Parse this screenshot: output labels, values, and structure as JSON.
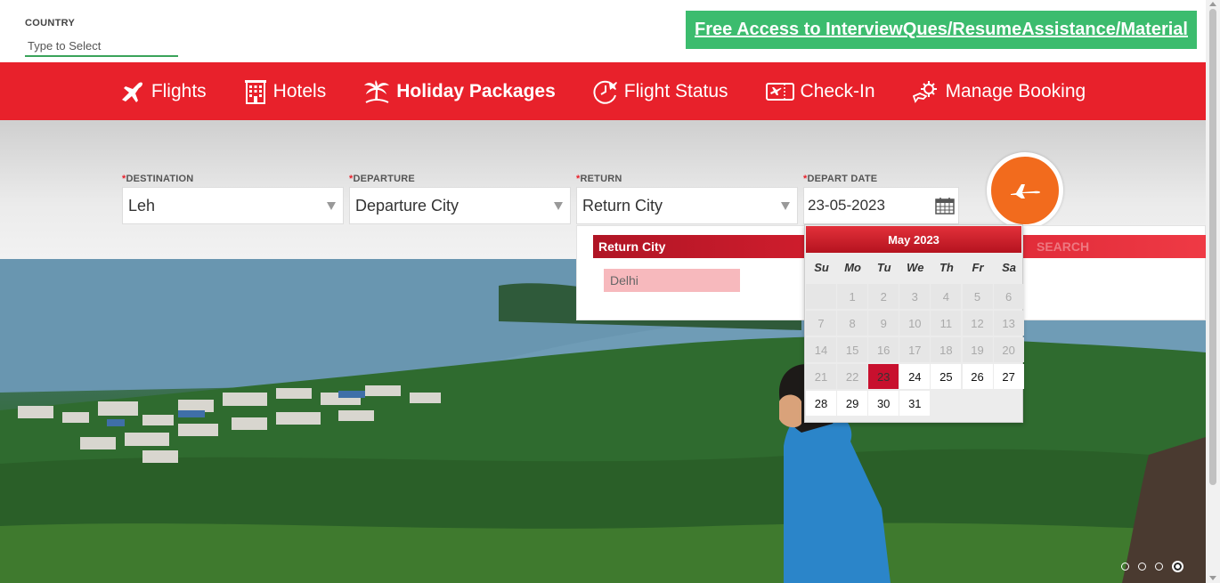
{
  "country": {
    "label": "COUNTRY",
    "placeholder": "Type to Select"
  },
  "promo": {
    "label": "Free Access to InterviewQues/ResumeAssistance/Material"
  },
  "nav": {
    "items": [
      {
        "label": "Flights",
        "icon": "airplane-icon"
      },
      {
        "label": "Hotels",
        "icon": "hotel-building-icon"
      },
      {
        "label": "Holiday Packages",
        "icon": "palm-tree-icon"
      },
      {
        "label": "Flight Status",
        "icon": "flight-clock-icon"
      },
      {
        "label": "Check-In",
        "icon": "boarding-pass-icon"
      },
      {
        "label": "Manage Booking",
        "icon": "gear-hand-icon"
      }
    ],
    "active": "Holiday Packages"
  },
  "form": {
    "destination": {
      "label": "DESTINATION",
      "required": "*",
      "value": "Leh"
    },
    "departure": {
      "label": "DEPARTURE",
      "required": "*",
      "value": "Departure City"
    },
    "return": {
      "label": "RETURN",
      "required": "*",
      "value": "Return City"
    },
    "depart_date": {
      "label": "DEPART DATE",
      "required": "*",
      "value": "23-05-2023"
    }
  },
  "return_dropdown": {
    "header": "Return City",
    "ghost_text": "SEARCH",
    "options": [
      "Delhi"
    ]
  },
  "calendar": {
    "month_label": "May 2023",
    "weekdays": [
      "Su",
      "Mo",
      "Tu",
      "We",
      "Th",
      "Fr",
      "Sa"
    ],
    "days": [
      {
        "d": "1",
        "state": "disabled"
      },
      {
        "d": "2",
        "state": "disabled"
      },
      {
        "d": "3",
        "state": "disabled"
      },
      {
        "d": "4",
        "state": "disabled"
      },
      {
        "d": "5",
        "state": "disabled"
      },
      {
        "d": "6",
        "state": "disabled"
      },
      {
        "d": "7",
        "state": "disabled"
      },
      {
        "d": "8",
        "state": "disabled"
      },
      {
        "d": "9",
        "state": "disabled"
      },
      {
        "d": "10",
        "state": "disabled"
      },
      {
        "d": "11",
        "state": "disabled"
      },
      {
        "d": "12",
        "state": "disabled"
      },
      {
        "d": "13",
        "state": "disabled"
      },
      {
        "d": "14",
        "state": "disabled"
      },
      {
        "d": "15",
        "state": "disabled"
      },
      {
        "d": "16",
        "state": "disabled"
      },
      {
        "d": "17",
        "state": "disabled"
      },
      {
        "d": "18",
        "state": "disabled"
      },
      {
        "d": "19",
        "state": "disabled"
      },
      {
        "d": "20",
        "state": "disabled"
      },
      {
        "d": "21",
        "state": "disabled"
      },
      {
        "d": "22",
        "state": "disabled"
      },
      {
        "d": "23",
        "state": "selected"
      },
      {
        "d": "24",
        "state": "enabled"
      },
      {
        "d": "25",
        "state": "enabled"
      },
      {
        "d": "26",
        "state": "enabled"
      },
      {
        "d": "27",
        "state": "enabled"
      },
      {
        "d": "28",
        "state": "enabled"
      },
      {
        "d": "29",
        "state": "enabled"
      },
      {
        "d": "30",
        "state": "enabled"
      },
      {
        "d": "31",
        "state": "enabled"
      }
    ],
    "first_weekday_index": 1
  },
  "carousel": {
    "slide_count": 4,
    "active_slide": 4
  },
  "colors": {
    "brand_red": "#e8212b",
    "promo_green": "#3cbc6e",
    "search_orange": "#f26b1d",
    "selected_day": "#c8102e"
  }
}
